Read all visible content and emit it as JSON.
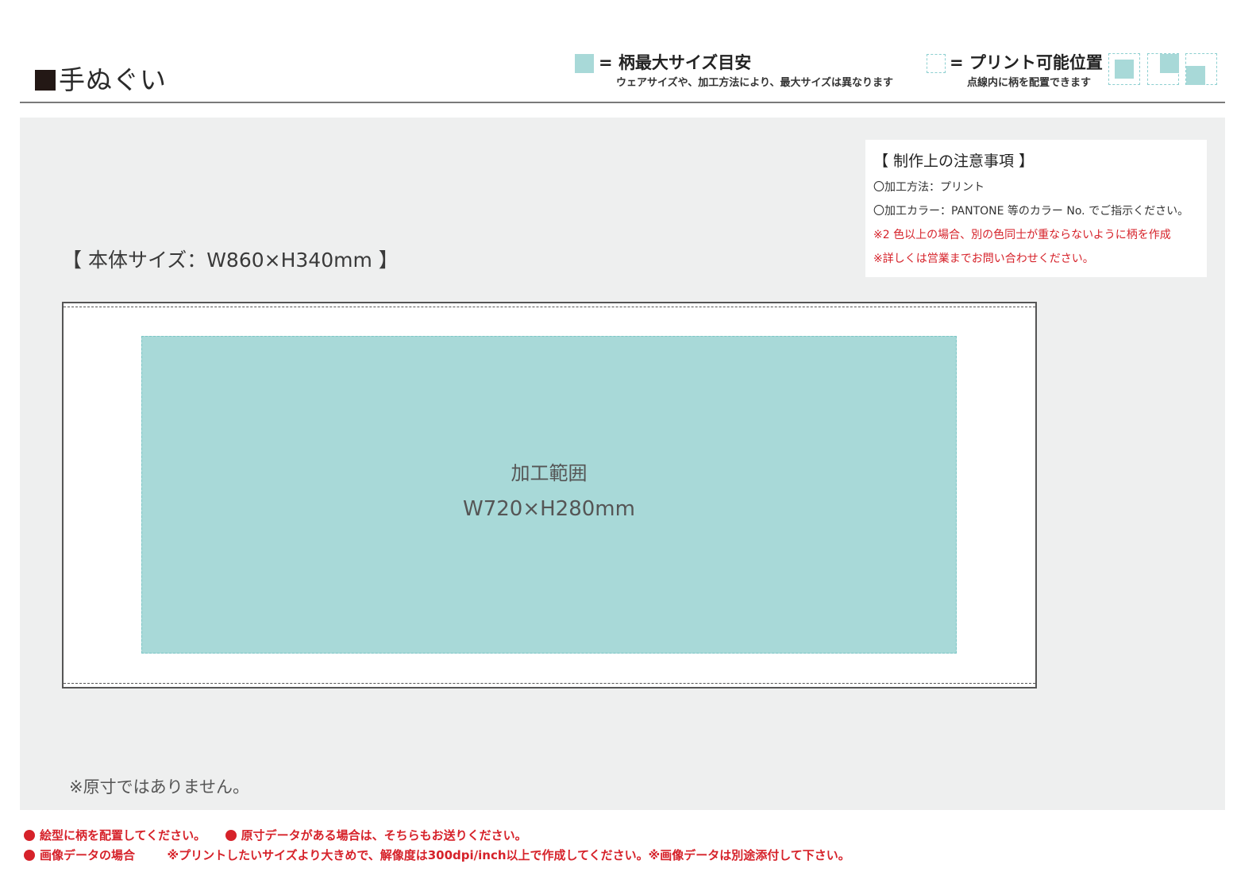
{
  "header": {
    "title": "手ぬぐい",
    "legend_max": {
      "label": "= 柄最大サイズ目安",
      "note": "ウェアサイズや、加工方法により、最大サイズは異なります"
    },
    "legend_print": {
      "label": "= プリント可能位置",
      "note": "点線内に柄を配置できます"
    }
  },
  "notes": {
    "title": "【 制作上の注意事項 】",
    "lines": [
      "〇加工方法：プリント",
      "〇加工カラー：PANTONE 等のカラー No. でご指示ください。",
      "※2 色以上の場合、別の色同士が重ならないように柄を作成",
      "※詳しくは営業までお問い合わせください。"
    ]
  },
  "body_size": "【 本体サイズ：W860×H340mm 】",
  "print_area": {
    "label": "加工範囲",
    "size": "W720×H280mm"
  },
  "not_actual_size": "※原寸ではありません。",
  "footer": {
    "line1_a": "絵型に柄を配置してください。",
    "line1_b": "原寸データがある場合は、そちらもお送りください。",
    "line2_a": "画像データの場合",
    "line2_b": "※プリントしたいサイズより大きめで、解像度は300dpi/inch以上で作成してください。※画像データは別途添付して下さい。"
  },
  "colors": {
    "print_area": "#a8d9d8",
    "print_area_border": "#7cc6c6",
    "panel_bg": "#eeefef",
    "warning_red": "#d6222a"
  }
}
